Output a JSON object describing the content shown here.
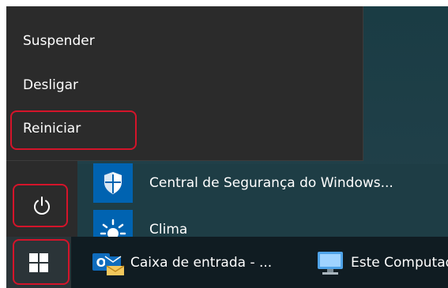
{
  "power_menu": {
    "items": [
      {
        "label": "Suspender"
      },
      {
        "label": "Desligar"
      },
      {
        "label": "Reiniciar"
      }
    ]
  },
  "app_list": [
    {
      "label": "Central de Segurança do Windows...",
      "icon": "shield-icon"
    },
    {
      "label": "Clima",
      "icon": "weather-icon"
    }
  ],
  "taskbar": {
    "items": [
      {
        "label": "Caixa de entrada - ...",
        "icon": "outlook-icon"
      },
      {
        "label": "Este Computador",
        "icon": "computer-icon"
      }
    ]
  },
  "colors": {
    "highlight": "#d4142a",
    "tile": "#0063b1",
    "menu_bg": "#2b2b2b"
  }
}
